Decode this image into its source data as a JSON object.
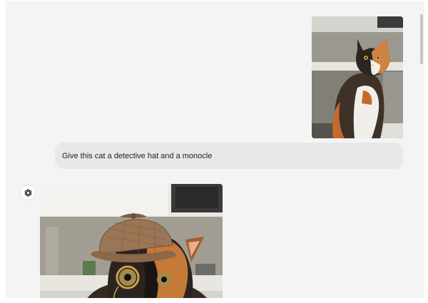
{
  "conversation": {
    "user_message": {
      "image_alt": "calico cat sitting in a kitchen",
      "text": "Give this cat a detective hat and a monocle"
    },
    "assistant_message": {
      "avatar_icon": "openai-logo-icon",
      "image_alt": "calico cat wearing a deerstalker hat and a monocle"
    }
  },
  "colors": {
    "panel_background": "#f4f4f4",
    "user_bubble": "#e8e8e8"
  }
}
